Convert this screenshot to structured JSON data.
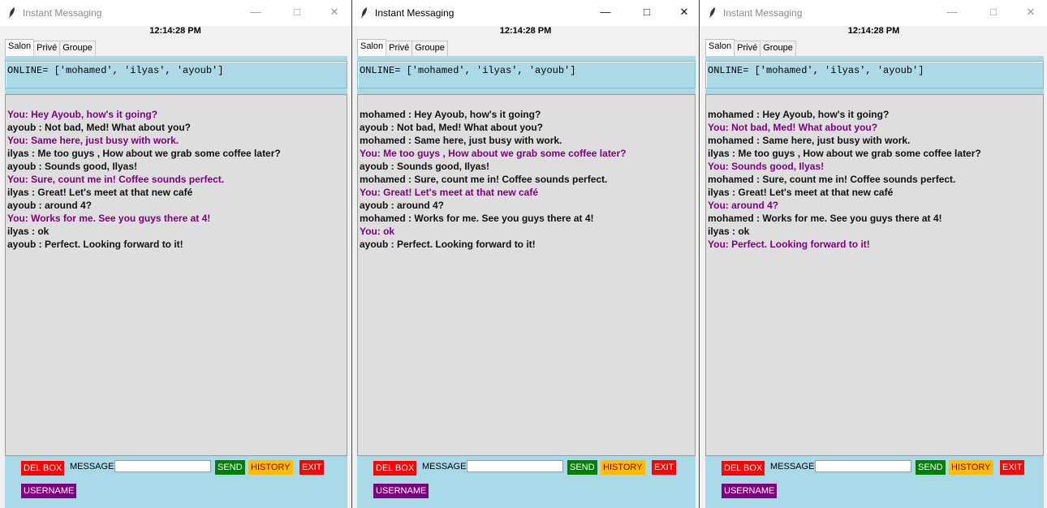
{
  "app_title": "Instant Messaging",
  "clock": "12:14:28 PM",
  "tabs": [
    "Salon",
    "Privé",
    "Groupe"
  ],
  "online_text": "ONLINE= ['mohamed', 'ilyas', 'ayoub']",
  "buttons": {
    "del_box": "DEL BOX",
    "message_label": "MESSAGE :",
    "send": "SEND",
    "history": "HISTORY",
    "exit": "EXIT",
    "username": "USERNAME"
  },
  "colors": {
    "own_message": "#800080",
    "panel_bg": "#add8e6",
    "chat_bg": "#dedede"
  },
  "windows": [
    {
      "messages": [
        {
          "text": "You: Hey Ayoub, how's it going?",
          "mine": true
        },
        {
          "text": "ayoub : Not bad, Med! What about you?",
          "mine": false
        },
        {
          "text": "You: Same here, just busy with work.",
          "mine": true
        },
        {
          "text": "ilyas : Me too guys , How about we grab some coffee later?",
          "mine": false
        },
        {
          "text": "ayoub : Sounds good, Ilyas!",
          "mine": false
        },
        {
          "text": "You:  Sure, count me in! Coffee sounds perfect.",
          "mine": true
        },
        {
          "text": "ilyas : Great! Let's meet at that new café",
          "mine": false
        },
        {
          "text": "ayoub :  around 4?",
          "mine": false
        },
        {
          "text": "You: Works for me. See you guys there at 4!",
          "mine": true
        },
        {
          "text": "ilyas : ok",
          "mine": false
        },
        {
          "text": "ayoub : Perfect. Looking forward to it!",
          "mine": false
        }
      ]
    },
    {
      "messages": [
        {
          "text": "mohamed : Hey Ayoub, how's it going?",
          "mine": false
        },
        {
          "text": "ayoub : Not bad, Med! What about you?",
          "mine": false
        },
        {
          "text": "mohamed : Same here, just busy with work.",
          "mine": false
        },
        {
          "text": "You: Me too guys , How about we grab some coffee later?",
          "mine": true
        },
        {
          "text": "ayoub : Sounds good, Ilyas!",
          "mine": false
        },
        {
          "text": "mohamed :  Sure, count me in! Coffee sounds perfect.",
          "mine": false
        },
        {
          "text": "You: Great! Let's meet at that new café",
          "mine": true
        },
        {
          "text": "ayoub :  around 4?",
          "mine": false
        },
        {
          "text": "mohamed : Works for me. See you guys there at 4!",
          "mine": false
        },
        {
          "text": "You: ok",
          "mine": true
        },
        {
          "text": "ayoub : Perfect. Looking forward to it!",
          "mine": false
        }
      ]
    },
    {
      "messages": [
        {
          "text": "mohamed : Hey Ayoub, how's it going?",
          "mine": false
        },
        {
          "text": "You: Not bad, Med! What about you?",
          "mine": true
        },
        {
          "text": "mohamed : Same here, just busy with work.",
          "mine": false
        },
        {
          "text": "ilyas : Me too guys , How about we grab some coffee later?",
          "mine": false
        },
        {
          "text": "You: Sounds good, Ilyas!",
          "mine": true
        },
        {
          "text": "mohamed :  Sure, count me in! Coffee sounds perfect.",
          "mine": false
        },
        {
          "text": "ilyas : Great! Let's meet at that new café",
          "mine": false
        },
        {
          "text": "You:  around 4?",
          "mine": true
        },
        {
          "text": "mohamed : Works for me. See you guys there at 4!",
          "mine": false
        },
        {
          "text": "ilyas : ok",
          "mine": false
        },
        {
          "text": "You: Perfect. Looking forward to it!",
          "mine": true
        }
      ]
    }
  ]
}
